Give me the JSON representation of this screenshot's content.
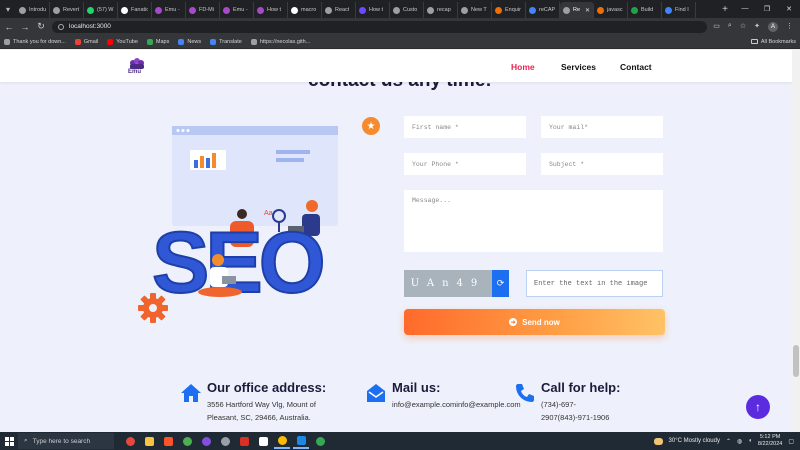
{
  "browser": {
    "tabs": [
      {
        "label": "Introdu",
        "color": "#9aa0a6"
      },
      {
        "label": "Revert",
        "color": "#9aa0a6"
      },
      {
        "label": "(57) W",
        "color": "#25d366"
      },
      {
        "label": "Fanatic",
        "color": "#ffffff"
      },
      {
        "label": "Emu -",
        "color": "#a64ac9"
      },
      {
        "label": "FD-Mi",
        "color": "#a64ac9"
      },
      {
        "label": "Emu -",
        "color": "#a64ac9"
      },
      {
        "label": "How t",
        "color": "#a64ac9"
      },
      {
        "label": "macro",
        "color": "#ffffff"
      },
      {
        "label": "React",
        "color": "#9aa0a6"
      },
      {
        "label": "How t",
        "color": "#6d4aff"
      },
      {
        "label": "Custo",
        "color": "#9aa0a6"
      },
      {
        "label": "recap",
        "color": "#9aa0a6"
      },
      {
        "label": "New T",
        "color": "#9aa0a6"
      },
      {
        "label": "Enquir",
        "color": "#e8710a"
      },
      {
        "label": "reCAP",
        "color": "#4285f4"
      },
      {
        "label": "Re",
        "color": "#9aa0a6",
        "active": true
      },
      {
        "label": "javasc",
        "color": "#e8710a"
      },
      {
        "label": "Build",
        "color": "#24a148"
      },
      {
        "label": "Find I",
        "color": "#4285f4"
      }
    ],
    "url": "localhost:3000",
    "profile_initial": "A",
    "bookmarks": [
      {
        "label": "Thank you for down...",
        "color": "#9aa0a6"
      },
      {
        "label": "Gmail",
        "color": "#ea4335"
      },
      {
        "label": "YouTube",
        "color": "#ff0000"
      },
      {
        "label": "Maps",
        "color": "#34a853"
      },
      {
        "label": "News",
        "color": "#4285f4"
      },
      {
        "label": "Translate",
        "color": "#4285f4"
      },
      {
        "label": "https://necolas.gith...",
        "color": "#9aa0a6"
      }
    ],
    "all_bookmarks": "All Bookmarks"
  },
  "site": {
    "brand": "Emu",
    "nav": {
      "home": "Home",
      "services": "Services",
      "contact": "Contact"
    },
    "heading": "contact us any time!",
    "illustration_text": "SEO",
    "illustration_small": "Aa",
    "form": {
      "first_name": "First name *",
      "mail": "Your mail*",
      "phone": "Your Phone *",
      "subject": "Subject *",
      "message": "Message...",
      "captcha_text": "UAn49",
      "captcha_placeholder": "Enter the text in the image",
      "send": "Send now"
    },
    "info": {
      "office_title": "Our office address:",
      "office_line1": "3556 Hartford Way Vlg, Mount of",
      "office_line2": "Pleasant, SC, 29466, Australia.",
      "mail_title": "Mail us:",
      "mail_text": "info@example.cominfo@example.com",
      "call_title": "Call for help:",
      "call_line1": "(734)-697-",
      "call_line2": "2907(843)-971-1906"
    }
  },
  "taskbar": {
    "search_placeholder": "Type here to search",
    "weather": "30°C  Mostly cloudy",
    "time": "5:12 PM",
    "date": "8/22/2024"
  },
  "colors": {
    "accent": "#e5244f",
    "primary_blue": "#1d6ff2",
    "orange": "#ff7a35",
    "purple": "#5b2be0"
  }
}
